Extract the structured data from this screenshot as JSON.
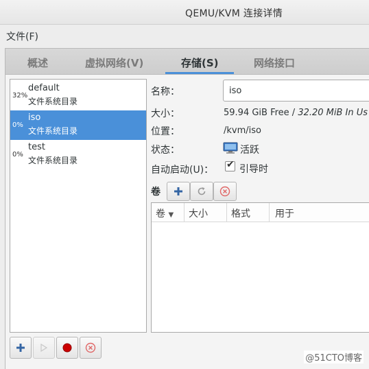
{
  "window": {
    "title": "QEMU/KVM 连接详情"
  },
  "menubar": {
    "file": "文件(F)"
  },
  "tabs": [
    {
      "label": "概述"
    },
    {
      "label": "虚拟网络(V)"
    },
    {
      "label": "存储(S)"
    },
    {
      "label": "网络接口"
    }
  ],
  "active_tab": "存储(S)",
  "pools": [
    {
      "usage": "32%",
      "name": "default",
      "type": "文件系统目录",
      "selected": false
    },
    {
      "usage": "0%",
      "name": "iso",
      "type": "文件系统目录",
      "selected": true
    },
    {
      "usage": "0%",
      "name": "test",
      "type": "文件系统目录",
      "selected": false
    }
  ],
  "details": {
    "name_label": "名称：",
    "name_value": "iso",
    "size_label": "大小：",
    "size_free": "59.94 GiB Free /",
    "size_alloc": "32.20 MiB In Us",
    "location_label": "位置：",
    "location_value": "/kvm/iso",
    "state_label": "状态：",
    "state_value": "活跃",
    "autostart_label": "自动启动(U)：",
    "autostart_value": "引导时"
  },
  "volumes": {
    "label": "卷",
    "columns": [
      "卷",
      "大小",
      "格式",
      "用于"
    ]
  },
  "watermark": "@51CTO博客",
  "colors": {
    "accent": "#4a90d9",
    "stop_red": "#cc0000"
  }
}
